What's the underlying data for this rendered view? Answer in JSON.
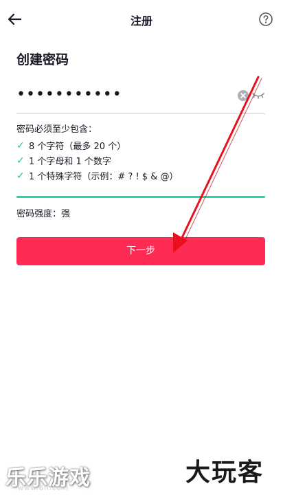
{
  "header": {
    "title": "注册"
  },
  "section_title": "创建密码",
  "password": {
    "value_masked": "•••••••••••"
  },
  "rules": {
    "title": "密码必须至少包含：",
    "items": [
      {
        "check": "✓",
        "label": "8 个字符（最多 20 个）"
      },
      {
        "check": "✓",
        "label": "1 个字母和 1 个数字"
      },
      {
        "check": "✓",
        "label": "1 个特殊字符（示例：# ? ! $ & @）"
      }
    ]
  },
  "strength": {
    "label": "密码强度：",
    "value": "强"
  },
  "next_button": {
    "label": "下一步"
  },
  "watermarks": {
    "left": "乐乐游戏",
    "left_url": "www.6ll.com",
    "right": "大玩客"
  },
  "colors": {
    "accent": "#fe2c55",
    "check": "#20c38c",
    "strength_bar": "#20d5a6",
    "annotation_arrow": "#e8101c"
  }
}
